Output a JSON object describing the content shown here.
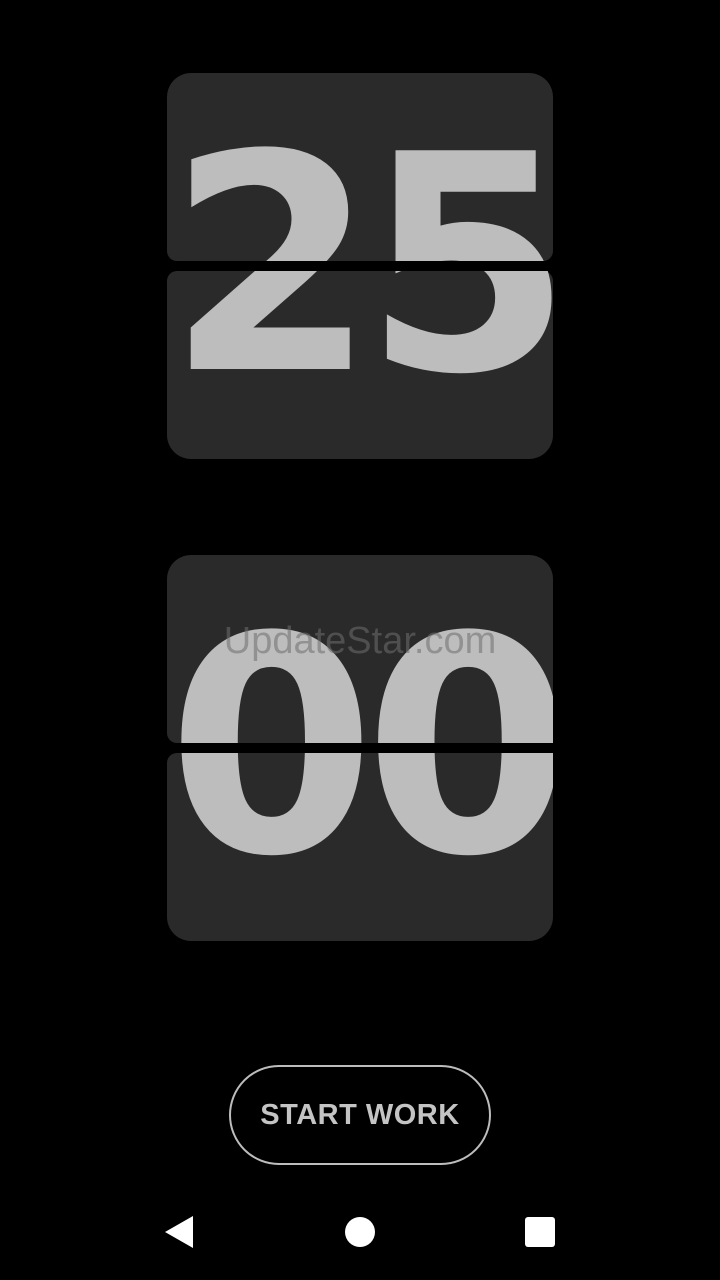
{
  "timer": {
    "minutes": "25",
    "seconds": "00"
  },
  "watermark": "UpdateStar.com",
  "start_button_label": "START WORK",
  "nav_bar": {
    "icons": [
      "back-icon",
      "home-icon",
      "recents-icon"
    ]
  },
  "colors": {
    "background": "#000000",
    "card": "#2a2a2a",
    "digits": "#bdbdbd",
    "button_border": "#bdbdbd"
  }
}
